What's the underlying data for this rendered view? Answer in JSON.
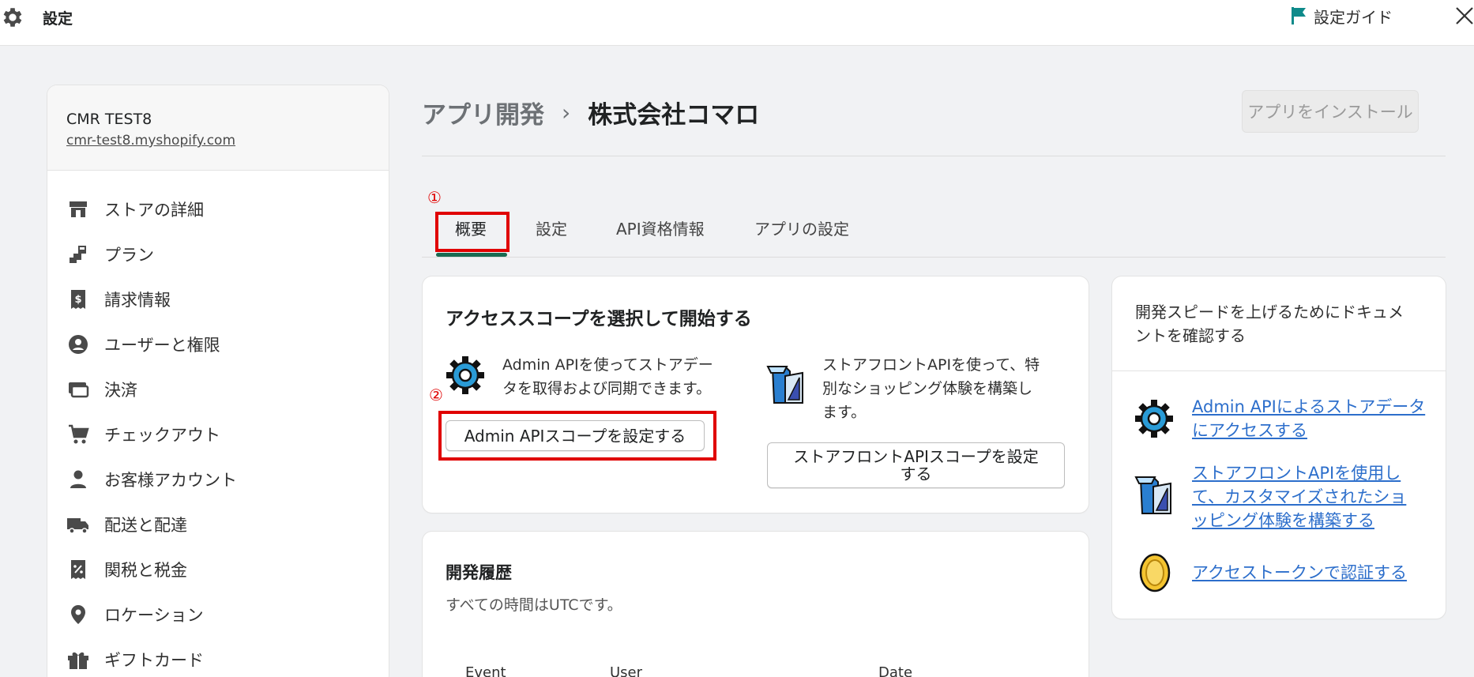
{
  "topbar": {
    "title": "設定",
    "guide_label": "設定ガイド"
  },
  "sidebar": {
    "store_name": "CMR TEST8",
    "store_url": "cmr-test8.myshopify.com",
    "items": [
      {
        "label": "ストアの詳細",
        "icon": "store-icon"
      },
      {
        "label": "プラン",
        "icon": "plan-icon"
      },
      {
        "label": "請求情報",
        "icon": "billing-icon"
      },
      {
        "label": "ユーザーと権限",
        "icon": "user-circle-icon"
      },
      {
        "label": "決済",
        "icon": "payment-icon"
      },
      {
        "label": "チェックアウト",
        "icon": "cart-icon"
      },
      {
        "label": "お客様アカウント",
        "icon": "person-icon"
      },
      {
        "label": "配送と配達",
        "icon": "truck-icon"
      },
      {
        "label": "関税と税金",
        "icon": "tax-icon"
      },
      {
        "label": "ロケーション",
        "icon": "location-icon"
      },
      {
        "label": "ギフトカード",
        "icon": "gift-icon"
      }
    ]
  },
  "header": {
    "breadcrumb_parent": "アプリ開発",
    "breadcrumb_current": "株式会社コマロ",
    "install_button": "アプリをインストール"
  },
  "annotations": {
    "one": "①",
    "two": "②"
  },
  "tabs": [
    {
      "label": "概要",
      "active": true
    },
    {
      "label": "設定"
    },
    {
      "label": "API資格情報"
    },
    {
      "label": "アプリの設定"
    }
  ],
  "access_card": {
    "title": "アクセススコープを選択して開始する",
    "admin_desc_line1": "Admin APIを使ってストアデー",
    "admin_desc_line2": "タを取得および同期できます。",
    "admin_button": "Admin APIスコープを設定する",
    "storefront_desc_line1": "ストアフロントAPIを使って、特",
    "storefront_desc_line2": "別なショッピング体験を構築し",
    "storefront_desc_line3": "ます。",
    "storefront_button_line1": "ストアフロントAPIスコープを設定",
    "storefront_button_line2": "する"
  },
  "history_card": {
    "title": "開発履歴",
    "note": "すべての時間はUTCです。",
    "columns": [
      "Event",
      "User",
      "Date"
    ]
  },
  "docs_card": {
    "title_line1": "開発スピードを上げるためにドキュメ",
    "title_line2": "ントを確認する",
    "link1_line1": "Admin APIによるストアデータ",
    "link1_line2": "にアクセスする",
    "link2_line1": "ストアフロントAPIを使用し",
    "link2_line2": "て、カスタマイズされたショ",
    "link2_line3": "ッピング体験を構築する",
    "link3": "アクセストークンで認証する"
  },
  "colors": {
    "accent": "#1a6b52",
    "link": "#2c6ecb",
    "annotation": "#e00000"
  }
}
